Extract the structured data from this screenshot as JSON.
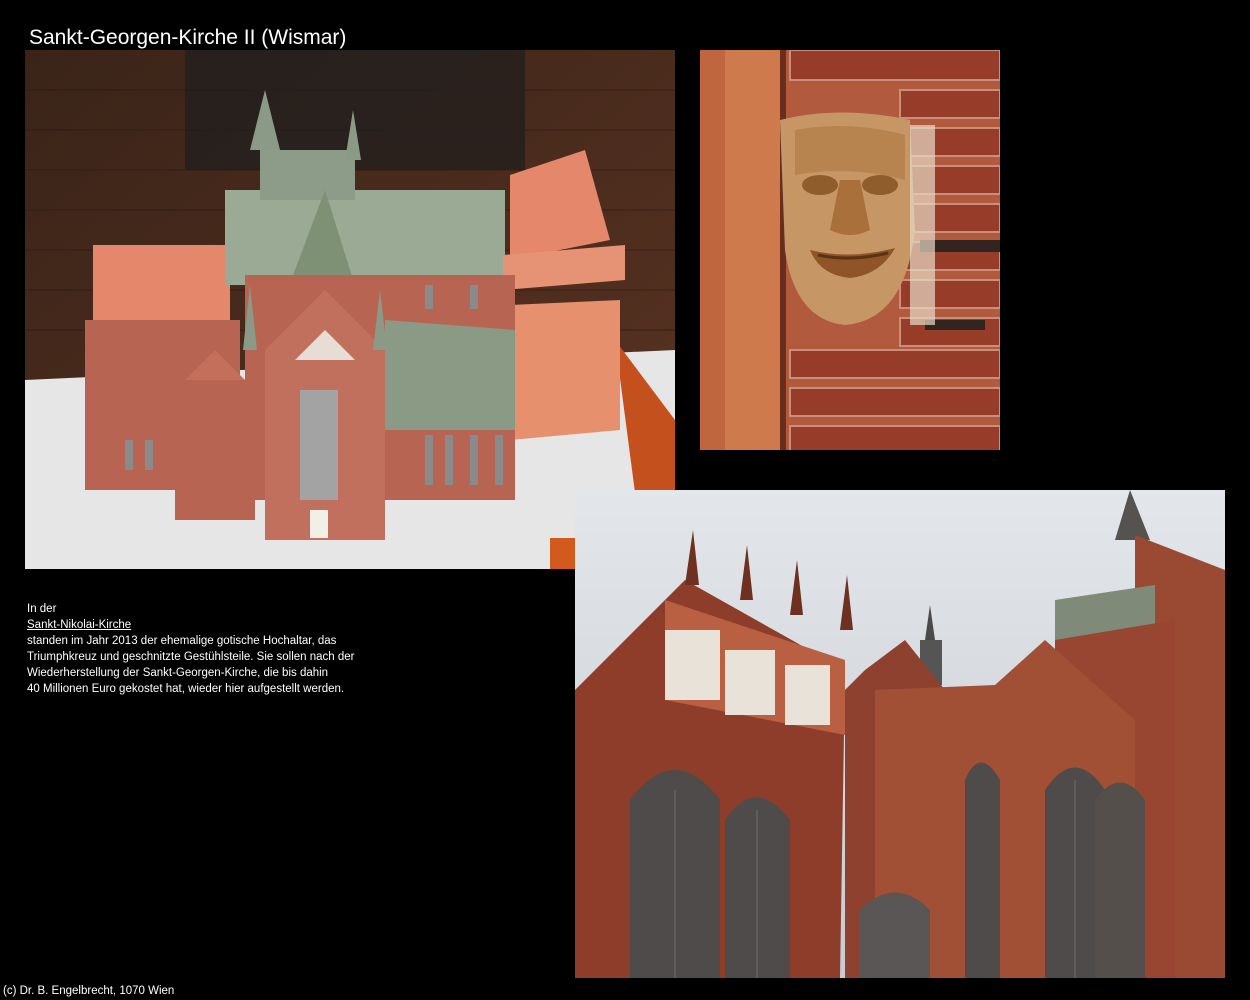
{
  "page": {
    "title": "Sankt-Georgen-Kirche II (Wismar)"
  },
  "caption": {
    "intro": "In der",
    "link_text": "Sankt-Nikolai-Kirche",
    "line1": "standen im Jahr 2013 der ehemalige gotische Hochaltar, das",
    "line2": "Triumphkreuz und geschnitzte Gestühlsteile. Sie sollen nach der",
    "line3": "Wiederherstellung der Sankt-Georgen-Kirche, die bis dahin",
    "line4": "40 Millionen Euro gekostet hat, wieder hier aufgestellt werden."
  },
  "footer": {
    "copyright": "(c) Dr. B. Engelbrecht, 1070 Wien"
  },
  "colors": {
    "background": "#000000",
    "text": "#ffffff",
    "brick": "#a0523a",
    "roof_green": "#8fa58a",
    "sky": "#d6dbe0"
  }
}
